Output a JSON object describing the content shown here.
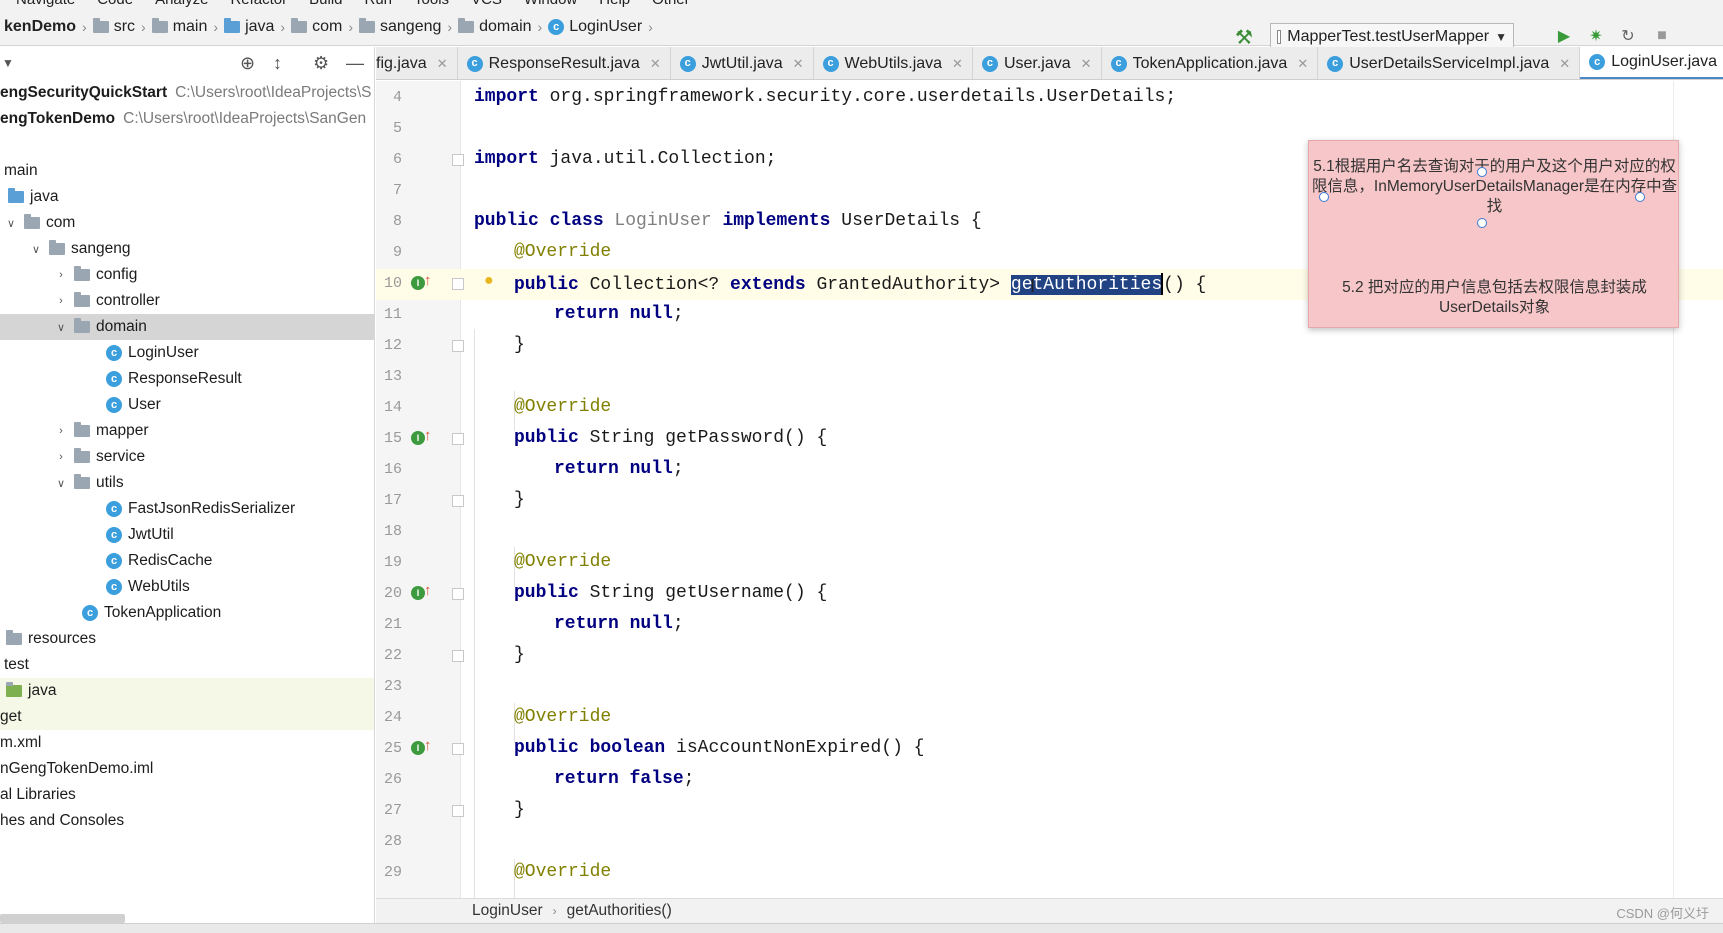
{
  "menu": [
    "Navigate",
    "Code",
    "Analyze",
    "Refactor",
    "Build",
    "Run",
    "Tools",
    "VCS",
    "Window",
    "Help",
    "Other"
  ],
  "breadcrumb": [
    "kenDemo",
    "src",
    "main",
    "java",
    "com",
    "sangeng",
    "domain",
    "LoginUser"
  ],
  "run_config": "MapperTest.testUserMapper",
  "tree": [
    {
      "label": "engSecurityQuickStart",
      "path": "C:\\Users\\root\\IdeaProjects\\S"
    },
    {
      "label": "engTokenDemo",
      "path": "C:\\Users\\root\\IdeaProjects\\SanGen"
    },
    {
      "label": "main"
    },
    {
      "label": "java"
    },
    {
      "label": "com"
    },
    {
      "label": "sangeng"
    },
    {
      "label": "config"
    },
    {
      "label": "controller"
    },
    {
      "label": "domain"
    },
    {
      "label": "LoginUser"
    },
    {
      "label": "ResponseResult"
    },
    {
      "label": "User"
    },
    {
      "label": "mapper"
    },
    {
      "label": "service"
    },
    {
      "label": "utils"
    },
    {
      "label": "FastJsonRedisSerializer"
    },
    {
      "label": "JwtUtil"
    },
    {
      "label": "RedisCache"
    },
    {
      "label": "WebUtils"
    },
    {
      "label": "TokenApplication"
    },
    {
      "label": "resources"
    },
    {
      "label": "test"
    },
    {
      "label": "java"
    },
    {
      "label": "get"
    },
    {
      "label": "m.xml"
    },
    {
      "label": "nGengTokenDemo.iml"
    },
    {
      "label": "al Libraries"
    },
    {
      "label": "hes and Consoles"
    }
  ],
  "tabs": [
    "fig.java",
    "ResponseResult.java",
    "JwtUtil.java",
    "WebUtils.java",
    "User.java",
    "TokenApplication.java",
    "UserDetailsServiceImpl.java",
    "LoginUser.java"
  ],
  "line_numbers": [
    "4",
    "5",
    "6",
    "7",
    "8",
    "9",
    "10",
    "11",
    "12",
    "13",
    "14",
    "15",
    "16",
    "17",
    "18",
    "19",
    "20",
    "21",
    "22",
    "23",
    "24",
    "25",
    "26",
    "27",
    "28",
    "29"
  ],
  "code": {
    "l4_kw": "import",
    "l4_rest": " org.springframework.security.core.userdetails.UserDetails;",
    "l6_kw": "import",
    "l6_rest": " java.util.Collection;",
    "l8_kw1": "public class",
    "l8_name": " LoginUser ",
    "l8_kw2": "implements",
    "l8_rest": " UserDetails {",
    "override": "@Override",
    "l10_kw1": "public",
    "l10_mid": " Collection<? ",
    "l10_kw2": "extends",
    "l10_mid2": " GrantedAuthority> ",
    "l10_sel": "getAuthorities",
    "l10_end": "() {",
    "return_kw": "return",
    "null_kw": " null",
    "semi": ";",
    "false_kw": " false",
    "close": "}",
    "l15_kw": "public",
    "l15_rest": " String getPassword() {",
    "l20_kw": "public",
    "l20_rest": " String getUsername() {",
    "l25_kw": "public boolean",
    "l25_rest": " isAccountNonExpired() {"
  },
  "note": {
    "text1": "5.1根据用户名去查询对于的用户及这个用户对应的权限信息，InMemoryUserDetailsManager是在内存中查找",
    "text2": "5.2 把对应的用户信息包括去权限信息封装成UserDetails对象"
  },
  "status": {
    "class": "LoginUser",
    "method": "getAuthorities()",
    "watermark": "CSDN @何义圩"
  }
}
